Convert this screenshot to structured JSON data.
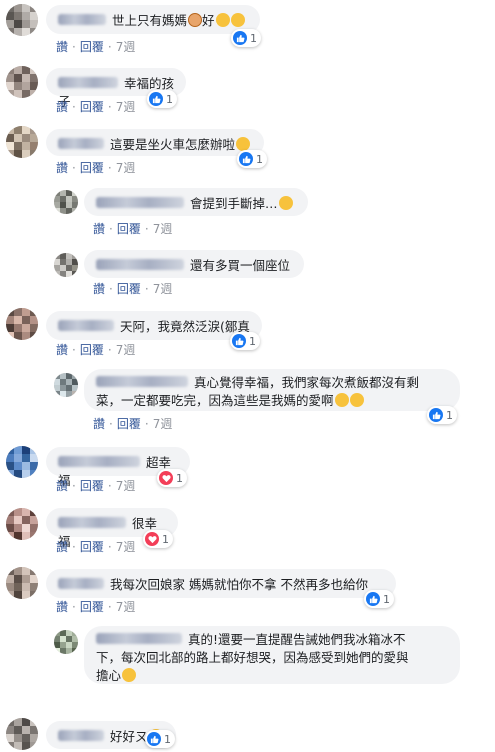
{
  "actions": {
    "reply_prefix": "讚",
    "reply": "回覆",
    "time": "7週",
    "sep": "·"
  },
  "colors": {
    "link": "#365899",
    "bubble": "#f2f3f5",
    "like": "#1877f2",
    "love": "#f33e58",
    "meta": "#90949c"
  },
  "comments": [
    {
      "text": "世上只有媽媽",
      "suffix": "好",
      "emojis_before_suffix": [
        "person-emoji"
      ],
      "emojis": [
        "smile-emoji",
        "smile-emoji"
      ],
      "reaction": "like",
      "count": "1"
    },
    {
      "text": "幸福的孩子",
      "emojis": [],
      "reaction": "like",
      "count": "1"
    },
    {
      "text": "這要是坐火車怎麼辦啦",
      "emojis": [
        "laugh-emoji"
      ],
      "reaction": "like",
      "count": "1"
    },
    {
      "text": "會提到手斷掉…",
      "emojis": [
        "shock-emoji"
      ],
      "reaction": null,
      "count": ""
    },
    {
      "text": "還有多買一個座位",
      "emojis": [],
      "reaction": null,
      "count": ""
    },
    {
      "text": "天阿，我竟然泛淚(鄒真",
      "emojis": [],
      "reaction": "like",
      "count": "1"
    },
    {
      "line1": "真心覺得幸福，我們家每次煮飯都沒有剩",
      "line2": "菜，一定都要吃完，因為這些是我媽的愛啊",
      "emojis": [
        "cry-emoji",
        "cry-emoji"
      ],
      "reaction": "like",
      "count": "1"
    },
    {
      "text": "超幸福",
      "emojis": [],
      "reaction": "love",
      "count": "1"
    },
    {
      "text": "很幸福",
      "emojis": [],
      "reaction": "love",
      "count": "1"
    },
    {
      "text": "我每次回娘家 媽媽就怕你不拿 不然再多也給你",
      "emojis": [],
      "reaction": "like",
      "count": "1"
    },
    {
      "line1": "真的!還要一直提醒告誡她們我冰箱冰不",
      "line2": "下，每次回北部的路上都好想哭，因為感受到她們的愛與",
      "line3": "擔心",
      "emojis": [
        "cry-emoji"
      ],
      "reaction": null,
      "count": ""
    },
    {
      "text": "好好ㄡ",
      "emojis": [
        "laugh-emoji"
      ],
      "reaction": "like",
      "count": "1"
    }
  ]
}
